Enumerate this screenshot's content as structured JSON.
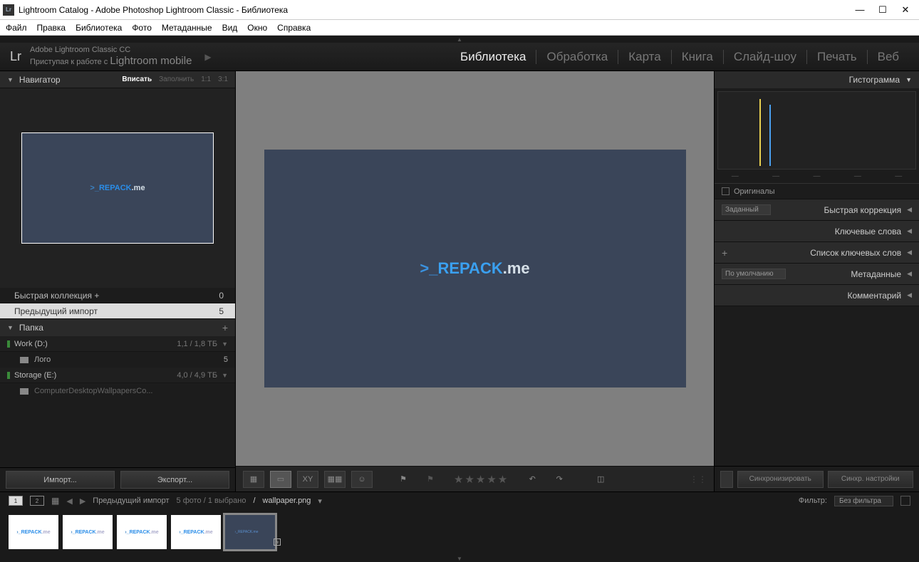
{
  "window": {
    "title": "Lightroom Catalog - Adobe Photoshop Lightroom Classic - Библиотека",
    "app_icon": "Lr"
  },
  "menubar": [
    "Файл",
    "Правка",
    "Библиотека",
    "Фото",
    "Метаданные",
    "Вид",
    "Окно",
    "Справка"
  ],
  "header": {
    "logo": "Lr",
    "subtitle_line1": "Adobe Lightroom Classic CC",
    "subtitle_line2a": "Приступая к работе с ",
    "subtitle_line2b": "Lightroom mobile",
    "play": "▶"
  },
  "modules": [
    {
      "label": "Библиотека",
      "active": true
    },
    {
      "label": "Обработка",
      "active": false
    },
    {
      "label": "Карта",
      "active": false
    },
    {
      "label": "Книга",
      "active": false
    },
    {
      "label": "Слайд-шоу",
      "active": false
    },
    {
      "label": "Печать",
      "active": false
    },
    {
      "label": "Веб",
      "active": false
    }
  ],
  "navigator": {
    "title": "Навигатор",
    "options": [
      {
        "label": "Вписать",
        "active": true
      },
      {
        "label": "Заполнить",
        "active": false
      },
      {
        "label": "1:1",
        "active": false
      },
      {
        "label": "3:1",
        "active": false
      }
    ],
    "logo": {
      "pre": ">_",
      "main": "REPACK",
      "suf": ".me"
    }
  },
  "catalog": {
    "quick": {
      "label": "Быстрая коллекция",
      "plus": "+",
      "count": "0"
    },
    "prev": {
      "label": "Предыдущий импорт",
      "count": "5"
    }
  },
  "folders": {
    "title": "Папка",
    "drives": [
      {
        "name": "Work (D:)",
        "size": "1,1 / 1,8 ТБ",
        "children": [
          {
            "name": "Лого",
            "count": "5"
          }
        ]
      },
      {
        "name": "Storage (E:)",
        "size": "4,0 / 4,9 ТБ",
        "children": [
          {
            "name": "ComputerDesktopWallpapersCo...",
            "count": ""
          }
        ]
      }
    ]
  },
  "left_buttons": {
    "import": "Импорт...",
    "export": "Экспорт..."
  },
  "main_logo": {
    "pre": ">_",
    "main": "REPACK",
    "suf": ".me"
  },
  "toolbar_icons": {
    "grid": "▦",
    "loupe": "▭",
    "compare": "XY",
    "survey": "▦▦",
    "people": "☺",
    "flag": "⚑",
    "reject": "⚑",
    "rotL": "↶",
    "rotR": "↷",
    "crop": "◫"
  },
  "stars": "★★★★★",
  "right": {
    "histogram": "Гистограмма",
    "originals": "Оригиналы",
    "sections": [
      {
        "left_type": "select",
        "left": "Заданный",
        "title": "Быстрая коррекция"
      },
      {
        "left_type": "none",
        "title": "Ключевые слова"
      },
      {
        "left_type": "plus",
        "title": "Список ключевых слов"
      },
      {
        "left_type": "select",
        "left": "По умолчанию",
        "title": "Метаданные"
      },
      {
        "left_type": "none",
        "title": "Комментарий"
      }
    ],
    "sync1": "Синхронизировать",
    "sync2": "Синхр. настройки"
  },
  "filmstrip_info": {
    "mon1": "1",
    "mon2": "2",
    "location": "Предыдущий импорт",
    "counts": "5 фото  /  1 выбрано",
    "sep": "/",
    "filename": "wallpaper.png",
    "filter_label": "Фильтр:",
    "filter_value": "Без фильтра"
  },
  "thumbs": [
    {
      "light": true,
      "selected": false
    },
    {
      "light": true,
      "selected": false
    },
    {
      "light": true,
      "selected": false
    },
    {
      "light": true,
      "selected": false
    },
    {
      "light": false,
      "selected": true
    }
  ],
  "thumb_logo": {
    "main": "REPACK",
    "suf": ".me"
  }
}
